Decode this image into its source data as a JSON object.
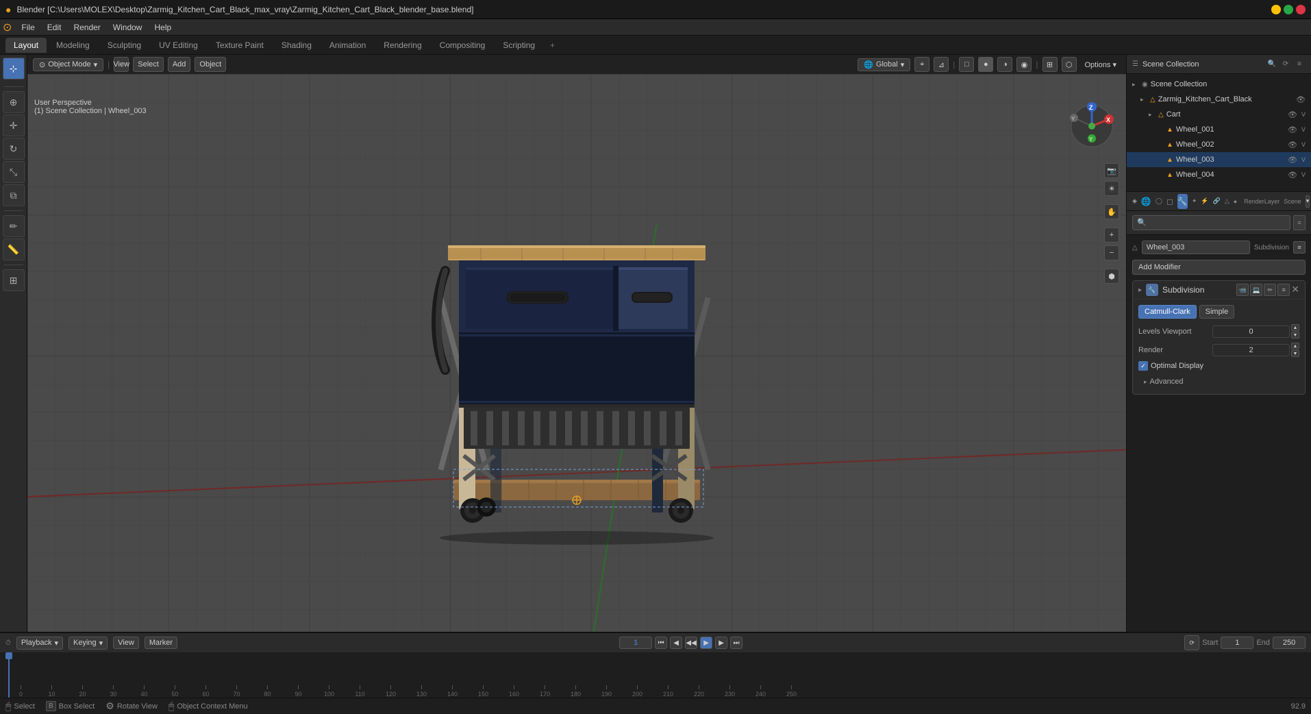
{
  "titlebar": {
    "title": "Blender [C:\\Users\\MOLEX\\Desktop\\Zarmig_Kitchen_Cart_Black_max_vray\\Zarmig_Kitchen_Cart_Black_blender_base.blend]"
  },
  "menu": {
    "items": [
      "Blender",
      "File",
      "Edit",
      "Render",
      "Window",
      "Help"
    ]
  },
  "workspace_tabs": {
    "tabs": [
      "Layout",
      "Modeling",
      "Sculpting",
      "UV Editing",
      "Texture Paint",
      "Shading",
      "Animation",
      "Rendering",
      "Compositing",
      "Scripting",
      "+"
    ],
    "active": "Layout"
  },
  "viewport": {
    "mode": "Object Mode",
    "chevron": "▾",
    "view_label": "View",
    "select_label": "Select",
    "add_label": "Add",
    "object_label": "Object",
    "global_label": "Global",
    "info_line1": "User Perspective",
    "info_line2": "(1) Scene Collection | Wheel_003",
    "options_label": "Options ▾",
    "zoom": "92.9"
  },
  "outliner": {
    "title": "Scene Collection",
    "search_placeholder": "🔍",
    "items": [
      {
        "name": "Zarmig_Kitchen_Cart_Black",
        "icon": "▸",
        "indent": 0,
        "eye": true
      },
      {
        "name": "Cart",
        "icon": "▸",
        "indent": 1,
        "eye": true
      },
      {
        "name": "Wheel_001",
        "icon": "",
        "indent": 2,
        "eye": true
      },
      {
        "name": "Wheel_002",
        "icon": "",
        "indent": 2,
        "eye": true
      },
      {
        "name": "Wheel_003",
        "icon": "",
        "indent": 2,
        "eye": true,
        "selected": true
      },
      {
        "name": "Wheel_004",
        "icon": "",
        "indent": 2,
        "eye": true
      }
    ]
  },
  "properties": {
    "object_name": "Wheel_003",
    "modifier_title": "Subdivision",
    "add_modifier_label": "Add Modifier",
    "catmull_clark": "Catmull-Clark",
    "simple": "Simple",
    "levels_viewport_label": "Levels Viewport",
    "levels_viewport_value": "0",
    "render_label": "Render",
    "render_value": "2",
    "optimal_display_label": "Optimal Display",
    "optimal_display_checked": true,
    "advanced_label": "Advanced"
  },
  "timeline": {
    "playback_label": "Playback",
    "keying_label": "Keying",
    "view_label": "View",
    "marker_label": "Marker",
    "start_label": "Start",
    "start_value": "1",
    "end_label": "End",
    "end_value": "250",
    "current_frame": "1",
    "frame_marks": [
      "0",
      "10",
      "20",
      "30",
      "40",
      "50",
      "60",
      "70",
      "80",
      "90",
      "100",
      "110",
      "120",
      "130",
      "140",
      "150",
      "160",
      "170",
      "180",
      "190",
      "200",
      "210",
      "220",
      "230",
      "240",
      "250"
    ]
  },
  "statusbar": {
    "select_label": "Select",
    "box_select_label": "Box Select",
    "rotate_view_label": "Rotate View",
    "object_context_label": "Object Context Menu",
    "zoom_value": "92.9"
  },
  "props_sidebar": {
    "icons": [
      "📷",
      "🌐",
      "📐",
      "⚙",
      "🔧",
      "🎨",
      "📊",
      "🔲",
      "⚡"
    ]
  }
}
